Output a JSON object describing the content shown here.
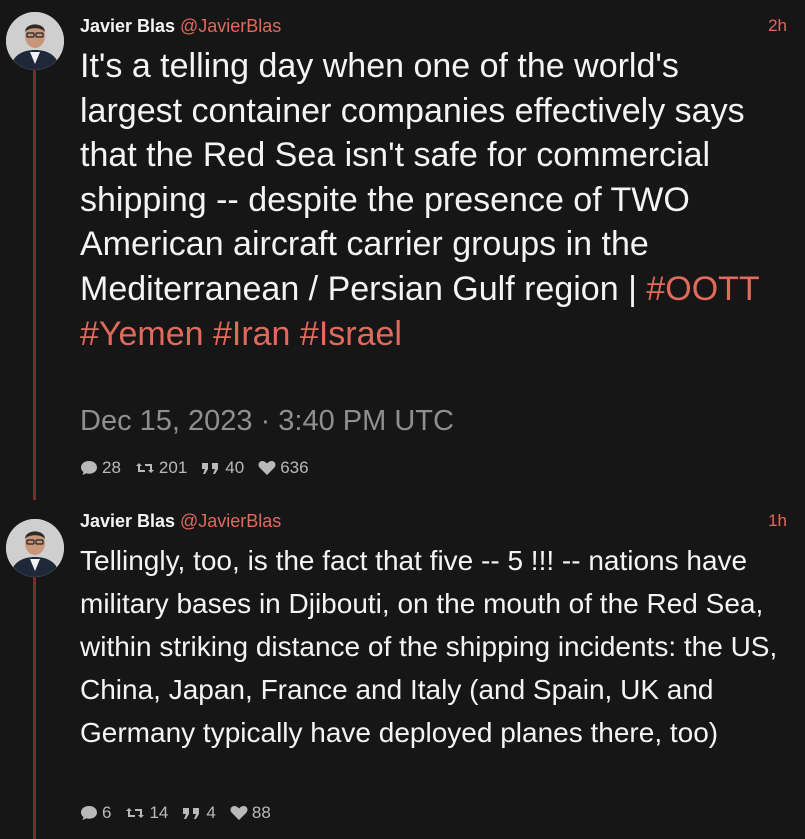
{
  "tweets": [
    {
      "author": "Javier Blas",
      "handle": "@JavierBlas",
      "time": "2h",
      "text_parts": [
        "It's a telling day when one of the world's largest container companies effectively says that the Red Sea isn't safe for commercial shipping -- despite the presence of TWO American aircraft carrier groups in the Mediterranean / Persian Gulf region | ",
        "#OOTT",
        " ",
        "#Yemen",
        " ",
        "#Iran",
        " ",
        "#Israel"
      ],
      "date": "Dec 15, 2023 · 3:40 PM UTC",
      "stats": {
        "replies": "28",
        "retweets": "201",
        "quotes": "40",
        "likes": "636"
      }
    },
    {
      "author": "Javier Blas",
      "handle": "@JavierBlas",
      "time": "1h",
      "text": "Tellingly, too, is the fact that five -- 5 !!! -- nations have military bases in Djibouti, on the mouth of the Red Sea, within striking distance of the shipping incidents: the US, China, Japan, France and Italy (and Spain, UK and Germany typically have deployed planes there, too)",
      "stats": {
        "replies": "6",
        "retweets": "14",
        "quotes": "4",
        "likes": "88"
      }
    }
  ],
  "colors": {
    "background": "#161616",
    "accent": "#e06a5c",
    "thread_line": "#7a2b2b",
    "muted": "#8f8f8f"
  },
  "icons": [
    "reply-icon",
    "retweet-icon",
    "quote-icon",
    "heart-icon"
  ]
}
